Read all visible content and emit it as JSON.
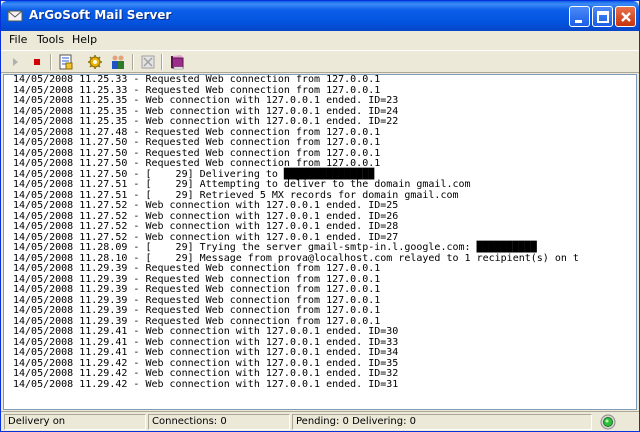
{
  "window": {
    "title": "ArGoSoft Mail Server"
  },
  "menu": {
    "file": "File",
    "tools": "Tools",
    "help": "Help"
  },
  "toolbar": {
    "icons": [
      "play-icon",
      "stop-icon",
      "options-icon",
      "settings-gear-icon",
      "users-icon",
      "disabled-icon",
      "help-book-icon"
    ]
  },
  "log": {
    "lines": [
      "14/05/2008 11.25.33 - Requested Web connection from 127.0.0.1",
      "14/05/2008 11.25.33 - Requested Web connection from 127.0.0.1",
      "14/05/2008 11.25.35 - Web connection with 127.0.0.1 ended. ID=23",
      "14/05/2008 11.25.35 - Web connection with 127.0.0.1 ended. ID=24",
      "14/05/2008 11.25.35 - Web connection with 127.0.0.1 ended. ID=22",
      "14/05/2008 11.27.48 - Requested Web connection from 127.0.0.1",
      "14/05/2008 11.27.50 - Requested Web connection from 127.0.0.1",
      "14/05/2008 11.27.50 - Requested Web connection from 127.0.0.1",
      "14/05/2008 11.27.50 - Requested Web connection from 127.0.0.1",
      "14/05/2008 11.27.50 - [    29] Delivering to ███████████████",
      "14/05/2008 11.27.51 - [    29] Attempting to deliver to the domain gmail.com",
      "14/05/2008 11.27.51 - [    29] Retrieved 5 MX records for domain gmail.com",
      "14/05/2008 11.27.52 - Web connection with 127.0.0.1 ended. ID=25",
      "14/05/2008 11.27.52 - Web connection with 127.0.0.1 ended. ID=26",
      "14/05/2008 11.27.52 - Web connection with 127.0.0.1 ended. ID=28",
      "14/05/2008 11.27.52 - Web connection with 127.0.0.1 ended. ID=27",
      "14/05/2008 11.28.09 - [    29] Trying the server gmail-smtp-in.l.google.com: ██████████",
      "14/05/2008 11.28.10 - [    29] Message from prova@localhost.com relayed to 1 recipient(s) on t",
      "14/05/2008 11.29.39 - Requested Web connection from 127.0.0.1",
      "14/05/2008 11.29.39 - Requested Web connection from 127.0.0.1",
      "14/05/2008 11.29.39 - Requested Web connection from 127.0.0.1",
      "14/05/2008 11.29.39 - Requested Web connection from 127.0.0.1",
      "14/05/2008 11.29.39 - Requested Web connection from 127.0.0.1",
      "14/05/2008 11.29.39 - Requested Web connection from 127.0.0.1",
      "14/05/2008 11.29.41 - Web connection with 127.0.0.1 ended. ID=30",
      "14/05/2008 11.29.41 - Web connection with 127.0.0.1 ended. ID=33",
      "14/05/2008 11.29.41 - Web connection with 127.0.0.1 ended. ID=34",
      "14/05/2008 11.29.42 - Web connection with 127.0.0.1 ended. ID=35",
      "14/05/2008 11.29.42 - Web connection with 127.0.0.1 ended. ID=32",
      "14/05/2008 11.29.42 - Web connection with 127.0.0.1 ended. ID=31"
    ]
  },
  "status": {
    "delivery": "Delivery on",
    "connections": "Connections: 0",
    "pending": "Pending: 0  Delivering: 0"
  },
  "colors": {
    "titlebar": "#0454e0",
    "log_bg": "#ffffff",
    "status_light": "#2fbf3a"
  }
}
